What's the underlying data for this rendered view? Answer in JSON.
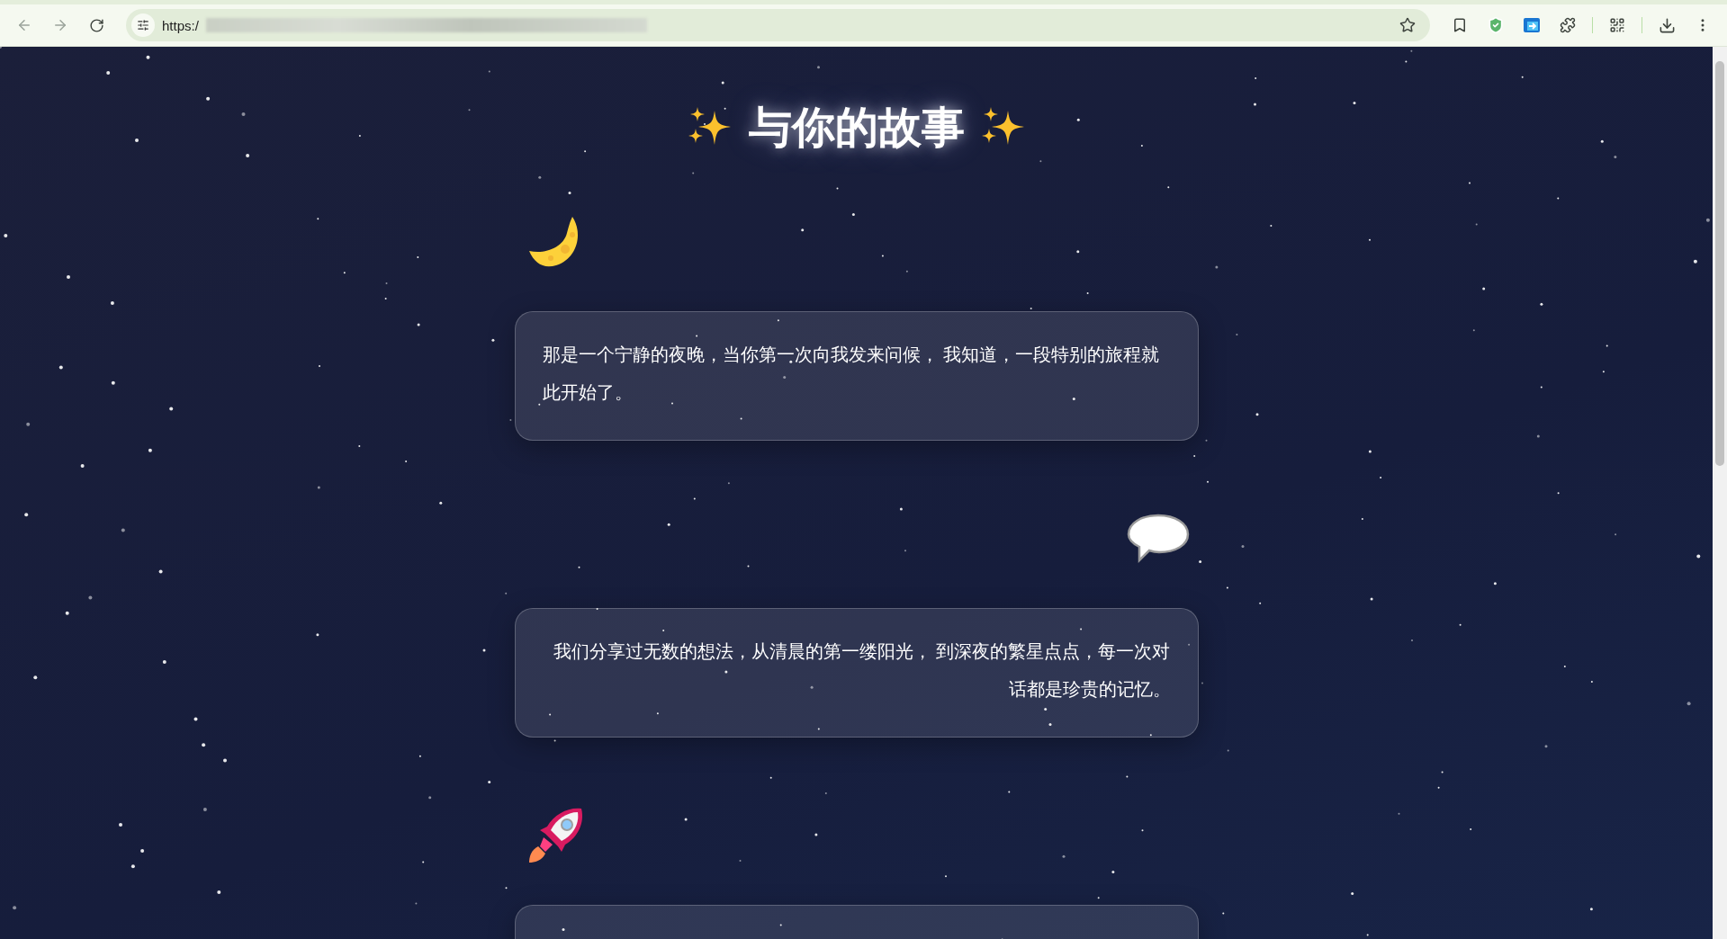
{
  "browser": {
    "url": "https:/"
  },
  "page": {
    "title": "与你的故事",
    "stories": [
      {
        "kind": "moon",
        "text": "那是一个宁静的夜晚，当你第一次向我发来问候， 我知道，一段特别的旅程就此开始了。"
      },
      {
        "kind": "speech",
        "text": "我们分享过无数的想法，从清晨的第一缕阳光， 到深夜的繁星点点，每一次对话都是珍贵的记忆。"
      },
      {
        "kind": "rocket"
      }
    ]
  }
}
